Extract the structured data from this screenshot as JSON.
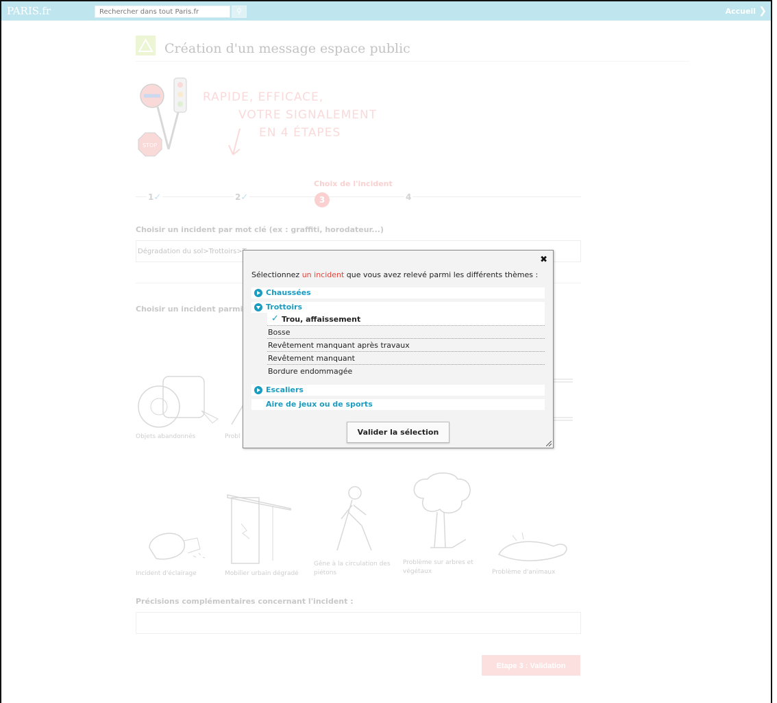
{
  "topbar": {
    "logo": "PARIS.fr",
    "search_placeholder": "Rechercher dans tout Paris.fr",
    "search_icon": "magnifier-icon",
    "home_label": "Accueil"
  },
  "page": {
    "title": "Création d'un message espace public",
    "slogan": [
      "RAPIDE, EFFICACE,",
      "VOTRE SIGNALEMENT",
      "EN 4 ÉTAPES"
    ],
    "steps": {
      "step1": "1",
      "step2": "2",
      "current_label": "Choix de l'incident",
      "current": "3",
      "step4": "4"
    },
    "keyword_label": "Choisir un incident par mot clé (ex : graffiti, horodateur...)",
    "keyword_value": "Dégradation du sol>Trottoirs>T",
    "theme_label": "Choisir un incident parmi",
    "categories": [
      "Objets abandonnés",
      "Probl",
      "Incident d'éclairage",
      "Mobilier urbain dégradé",
      "Gêne à la circulation des piétons",
      "Problème sur arbres et végétaux",
      "Problème d'animaux"
    ],
    "precisions_label": "Précisions complémentaires concernant l'incident :",
    "next_button": "Etape 3 : Validation"
  },
  "modal": {
    "intro_before": "Sélectionnez ",
    "intro_highlight": "un incident",
    "intro_after": " que vous avez relevé parmi les différents thèmes :",
    "themes": [
      {
        "label": "Chaussées"
      },
      {
        "label": "Trottoirs"
      },
      {
        "label": "Escaliers"
      },
      {
        "label": "Aire de jeux ou de sports"
      }
    ],
    "trottoirs_items": [
      {
        "label": "Trou, affaissement",
        "selected": true
      },
      {
        "label": "Bosse"
      },
      {
        "label": "Revêtement manquant après travaux"
      },
      {
        "label": "Revêtement manquant"
      },
      {
        "label": "Bordure endommagée"
      }
    ],
    "validate_button": "Valider la sélection"
  },
  "colors": {
    "topbar": "#bfe6ee",
    "accent_blue": "#1a9cc0",
    "accent_red": "#e0443b",
    "step_red": "#f07070"
  }
}
